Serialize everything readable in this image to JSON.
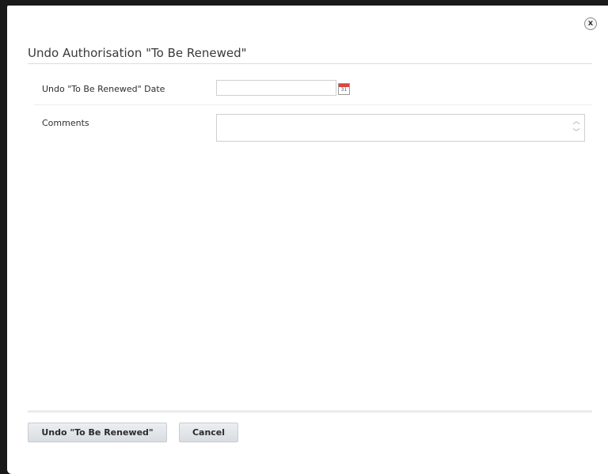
{
  "dialog": {
    "title": "Undo Authorisation \"To Be Renewed\"",
    "close_label": "x",
    "close_icon": "close-icon"
  },
  "form": {
    "date_label": "Undo \"To Be Renewed\" Date",
    "date_value": "",
    "calendar_icon": "calendar-icon",
    "calendar_day": "31",
    "comments_label": "Comments",
    "comments_value": "",
    "spin_up": "︿",
    "spin_down": "﹀"
  },
  "footer": {
    "undo_button": "Undo \"To Be Renewed\"",
    "cancel_button": "Cancel"
  }
}
